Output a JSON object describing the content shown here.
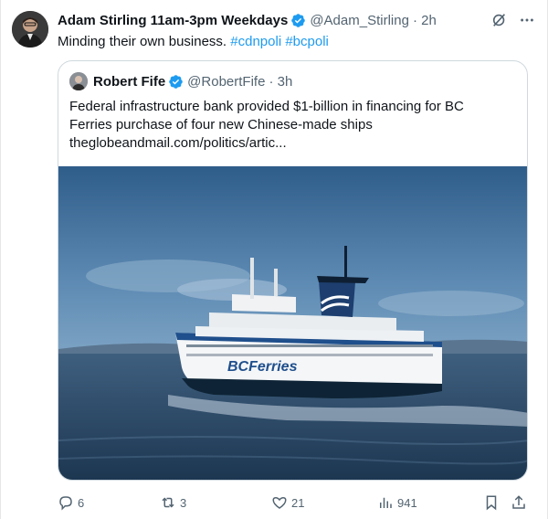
{
  "tweet": {
    "author_name": "Adam Stirling 11am-3pm Weekdays",
    "handle": "@Adam_Stirling",
    "time": "· 2h",
    "text": "Minding their own business.",
    "hashtags": [
      "#cdnpoli",
      "#bcpoli"
    ]
  },
  "quote": {
    "author_name": "Robert Fife",
    "handle": "@RobertFife",
    "time": "· 3h",
    "text_line1": "Federal infrastructure bank provided $1-billion in financing for BC",
    "text_line2": "Ferries purchase of four new Chinese-made ships",
    "link": "theglobeandmail.com/politics/artic...",
    "image": {
      "subject": "ferry-photo",
      "hull_text": "BCFerries"
    }
  },
  "actions": {
    "replies": "6",
    "retweets": "3",
    "likes": "21",
    "views": "941"
  },
  "colors": {
    "accent": "#1d9bf0",
    "muted": "#536471",
    "text": "#0f1419"
  }
}
